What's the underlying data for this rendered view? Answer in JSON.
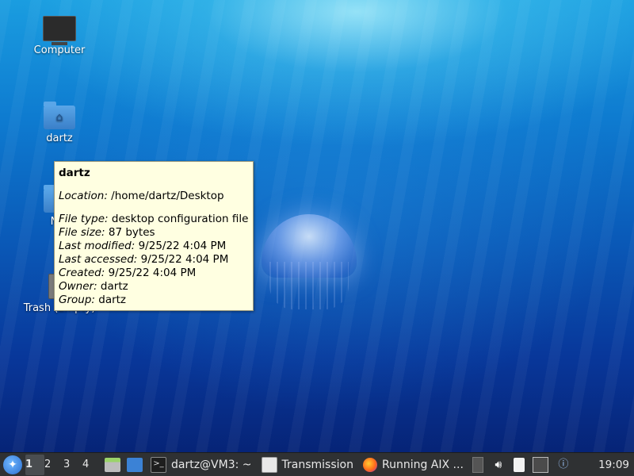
{
  "desktop": {
    "icons": [
      {
        "label": "Computer",
        "icon": "computer-icon"
      },
      {
        "label": "dartz",
        "icon": "home-folder-icon"
      },
      {
        "label": "Net",
        "icon": "network-folder-icon"
      },
      {
        "label": "Trash (Empty)",
        "icon": "trash-icon"
      }
    ]
  },
  "tooltip": {
    "title": "dartz",
    "location_key": "Location:",
    "location_val": " /home/dartz/Desktop",
    "filetype_key": "File type:",
    "filetype_val": " desktop configuration file",
    "filesize_key": "File size:",
    "filesize_val": " 87 bytes",
    "modified_key": "Last modified:",
    "modified_val": " 9/25/22 4:04 PM",
    "accessed_key": "Last accessed:",
    "accessed_val": " 9/25/22 4:04 PM",
    "created_key": "Created:",
    "created_val": " 9/25/22 4:04 PM",
    "owner_key": "Owner:",
    "owner_val": " dartz",
    "group_key": "Group:",
    "group_val": " dartz"
  },
  "taskbar": {
    "workspaces": [
      "1",
      "2",
      "3",
      "4"
    ],
    "active_workspace": "1",
    "tasks": [
      {
        "label": "dartz@VM3: ~",
        "icon": "terminal-icon"
      },
      {
        "label": "Transmission",
        "icon": "transmission-icon"
      },
      {
        "label": "Running AIX ...",
        "icon": "firefox-icon"
      }
    ],
    "clock": "19:09"
  },
  "colors": {
    "taskbar_bg": "#2f3133",
    "tooltip_bg": "#ffffe1",
    "accent": "#3a7fc8"
  }
}
